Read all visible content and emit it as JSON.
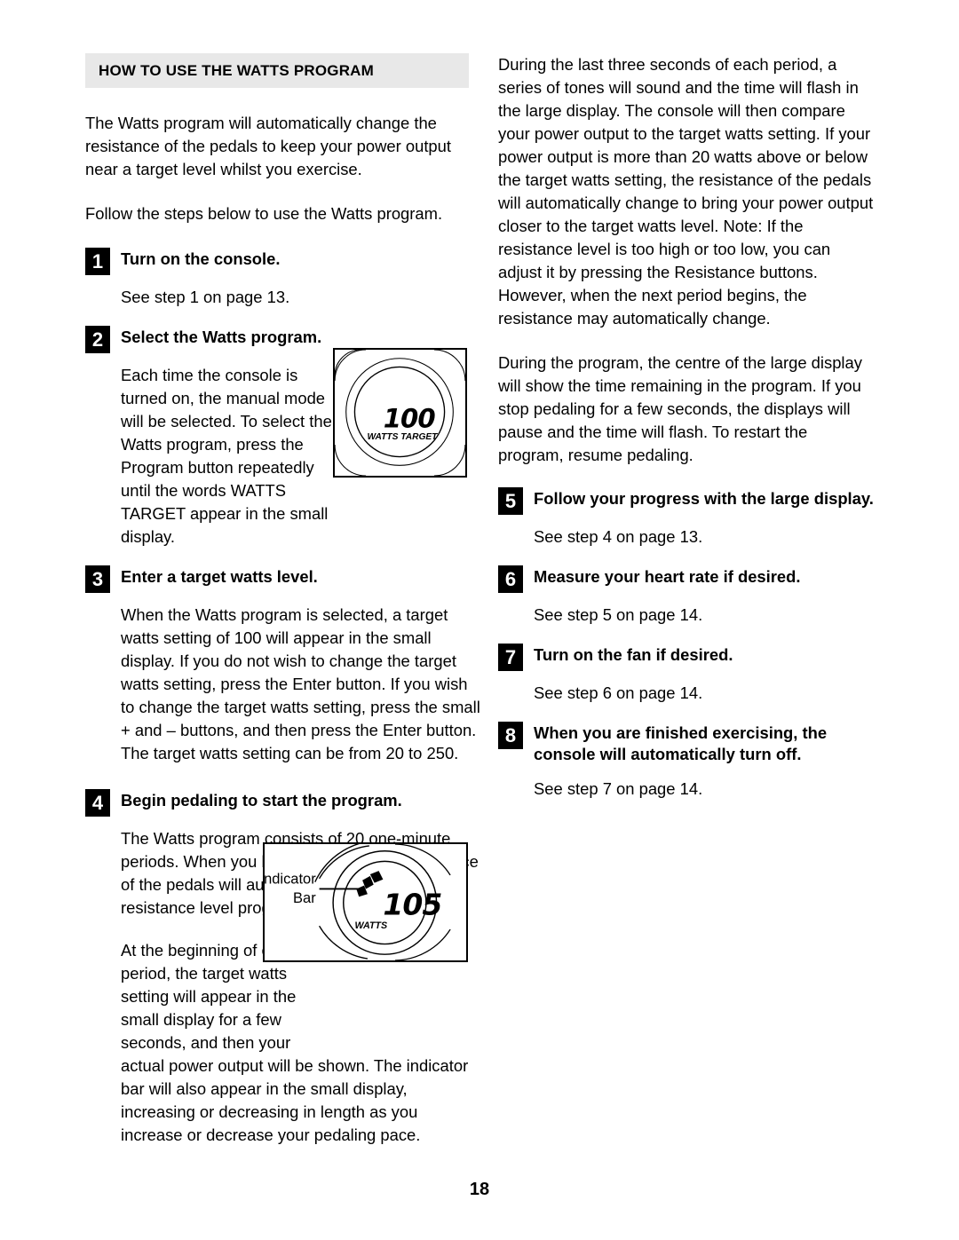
{
  "document": {
    "page_number": "18",
    "section_title": "HOW TO USE THE WATTS PROGRAM"
  },
  "colors": {
    "band_background": "#e8e8e8",
    "text": "#000000",
    "step_badge_background": "#000000",
    "step_badge_text": "#ffffff",
    "figure_border": "#000000"
  },
  "left_column": {
    "intro_paragraph_1": "The Watts program will automatically change the resistance of the pedals to keep your power output near a target level whilst you exercise.",
    "intro_paragraph_2": "Follow the steps below to use the Watts program.",
    "steps": [
      {
        "number": "1",
        "title": "Turn on the console.",
        "body": "See step 1 on page 13."
      },
      {
        "number": "2",
        "title": "Select the Watts program.",
        "body": "Each time the console is turned on, the manual mode will be selected. To select the Watts program, press the Program button repeatedly until the words WATTS TARGET appear in the small display."
      },
      {
        "number": "3",
        "title": "Enter a target watts level.",
        "body": "When the Watts program is selected, a target watts setting of 100 will appear in the small display. If you do not wish to change the target watts setting, press the Enter button. If you wish to change the target watts setting, press the small + and – buttons, and then press the Enter button. The target watts setting can be from 20 to 250."
      },
      {
        "number": "4",
        "title": "Begin pedaling to start the program.",
        "body_1": "The Watts program consists of 20 one-minute periods. When you begin pedaling, the resistance of the pedals will automatically change to the resistance level programmed for the first period.",
        "body_2": "At the beginning of each period, the target watts setting will appear in the small display for a few seconds, and then your",
        "body_3": "actual power output will be shown. The indicator bar will also appear in the small display, increasing or decreasing in length as you increase or decrease your pedaling pace."
      }
    ]
  },
  "right_column": {
    "paragraph_1": "During the last three seconds of each period, a series of tones will sound and the time will flash in the large display. The console will then compare your power output to the target watts setting. If your power output is more than 20 watts above or below the target watts setting, the resistance of the pedals will automatically change to bring your power output closer to the target watts level. Note: If the resistance level is too high or too low, you can adjust it by pressing the Resistance buttons. However, when the next period begins, the resistance may automatically change.",
    "paragraph_2": "During the program, the centre of the large display will show the time remaining in the program. If you stop pedaling for a few seconds, the displays will pause and the time will flash. To restart the program, resume pedaling.",
    "steps": [
      {
        "number": "5",
        "title": "Follow your progress with the large display.",
        "body": "See step 4 on page 13."
      },
      {
        "number": "6",
        "title": "Measure your heart rate if desired.",
        "body": "See step 5 on page 14."
      },
      {
        "number": "7",
        "title": "Turn on the fan if desired.",
        "body": "See step 6 on page 14."
      },
      {
        "number": "8",
        "title": "When you are finished exercising, the console will automatically turn off.",
        "body": "See step 7 on page 14."
      }
    ]
  },
  "figures": {
    "console_target": {
      "lcd_value": "100",
      "lcd_label": "WATTS TARGET"
    },
    "console_watts": {
      "lcd_value": "105",
      "lcd_label": "WATTS",
      "callout_line_1": "Indicator",
      "callout_line_2": "Bar"
    }
  }
}
